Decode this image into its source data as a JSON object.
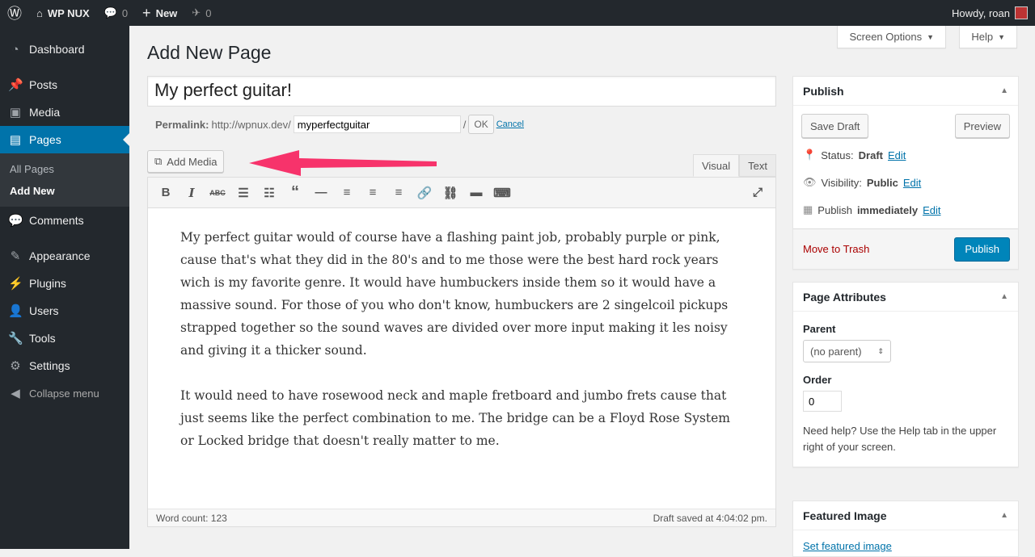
{
  "adminbar": {
    "site": "WP NUX",
    "comments": "0",
    "new": "New",
    "updates": "0",
    "howdy": "Howdy, roan"
  },
  "sidebar": {
    "items": [
      {
        "label": "Dashboard",
        "icon": "dashboard-icon"
      },
      {
        "label": "Posts",
        "icon": "pin-icon"
      },
      {
        "label": "Media",
        "icon": "media-icon"
      },
      {
        "label": "Pages",
        "icon": "page-icon"
      },
      {
        "label": "Comments",
        "icon": "comment-icon"
      },
      {
        "label": "Appearance",
        "icon": "brush-icon"
      },
      {
        "label": "Plugins",
        "icon": "plug-icon"
      },
      {
        "label": "Users",
        "icon": "user-icon"
      },
      {
        "label": "Tools",
        "icon": "wrench-icon"
      },
      {
        "label": "Settings",
        "icon": "settings-icon"
      }
    ],
    "sub": [
      "All Pages",
      "Add New"
    ],
    "collapse": "Collapse menu"
  },
  "header": {
    "screen_options": "Screen Options",
    "help": "Help",
    "title": "Add New Page"
  },
  "editor": {
    "title": "My perfect guitar!",
    "permalink_label": "Permalink:",
    "permalink_base": "http://wpnux.dev/",
    "slug": "myperfectguitar",
    "slash": "/",
    "ok": "OK",
    "cancel": "Cancel",
    "add_media": "Add Media",
    "tab_visual": "Visual",
    "tab_text": "Text",
    "paragraphs": [
      "My perfect guitar would of course have a flashing paint job, probably purple or pink, cause that's what they did in the 80's and to me those were the best hard rock years wich is my favorite genre. It would have humbuckers inside them so it would have a massive sound. For those of you who don't know, humbuckers are 2 singelcoil pickups strapped together so the sound waves are divided over more input making it les noisy and giving it a thicker sound.",
      "It would need to have rosewood neck and maple fretboard and jumbo frets cause that just seems like the perfect combination to me. The bridge can be a Floyd Rose System or Locked bridge that doesn't really matter to me."
    ],
    "word_count": "Word count: 123",
    "draft_saved": "Draft saved at 4:04:02 pm."
  },
  "publish": {
    "title": "Publish",
    "save_draft": "Save Draft",
    "preview": "Preview",
    "status_label": "Status:",
    "status": "Draft",
    "visibility_label": "Visibility:",
    "visibility": "Public",
    "publish_label": "Publish",
    "publish_when": "immediately",
    "edit": "Edit",
    "trash": "Move to Trash",
    "publish": "Publish"
  },
  "attributes": {
    "title": "Page Attributes",
    "parent_label": "Parent",
    "parent": "(no parent)",
    "order_label": "Order",
    "order": "0",
    "help": "Need help? Use the Help tab in the upper right of your screen."
  },
  "featured": {
    "title": "Featured Image",
    "link": "Set featured image"
  },
  "colors": {
    "accent": "#0073aa",
    "arrow": "#f7336b",
    "trash": "#a00"
  }
}
